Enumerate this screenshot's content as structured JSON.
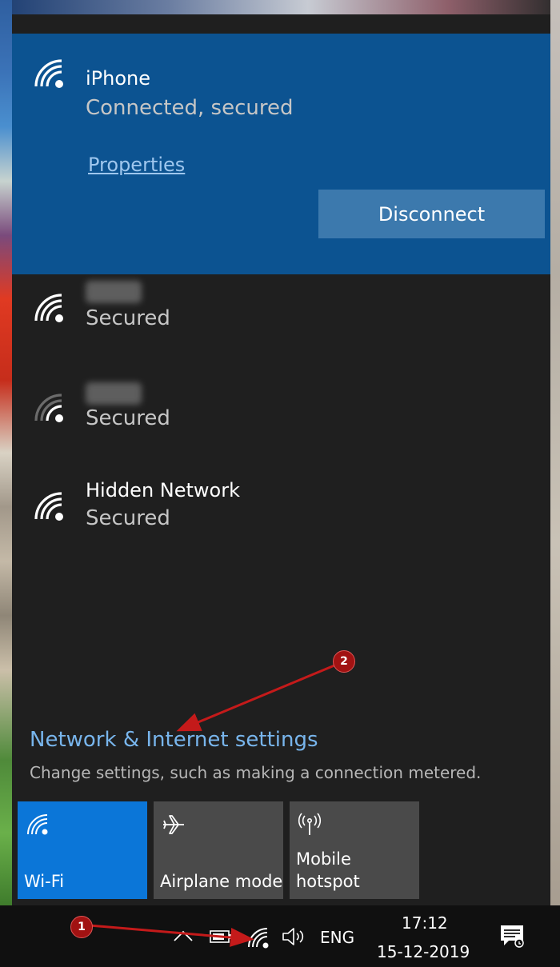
{
  "connected_network": {
    "name": "iPhone",
    "status": "Connected, secured",
    "properties_link": "Properties",
    "disconnect_button": "Disconnect"
  },
  "networks": [
    {
      "name": "",
      "status": "Secured",
      "signal": "strong",
      "name_obscured": true
    },
    {
      "name": "",
      "status": "Secured",
      "signal": "weak",
      "name_obscured": true
    },
    {
      "name": "Hidden Network",
      "status": "Secured",
      "signal": "strong",
      "name_obscured": false
    }
  ],
  "settings": {
    "link": "Network & Internet settings",
    "description": "Change settings, such as making a connection metered."
  },
  "quick_actions": [
    {
      "label": "Wi-Fi",
      "icon": "wifi-icon",
      "active": true
    },
    {
      "label": "Airplane mode",
      "icon": "airplane-icon",
      "active": false
    },
    {
      "label": "Mobile\nhotspot",
      "icon": "hotspot-icon",
      "active": false
    }
  ],
  "taskbar": {
    "language": "ENG",
    "time": "17:12",
    "date": "15-12-2019"
  },
  "annotations": [
    {
      "number": "1",
      "color": "#a11212"
    },
    {
      "number": "2",
      "color": "#a11212"
    }
  ],
  "colors": {
    "flyout_bg": "#1f1f1f",
    "connected_bg": "#0c5391",
    "accent_link": "#78b5ec",
    "active_tile": "#0b76d8"
  }
}
